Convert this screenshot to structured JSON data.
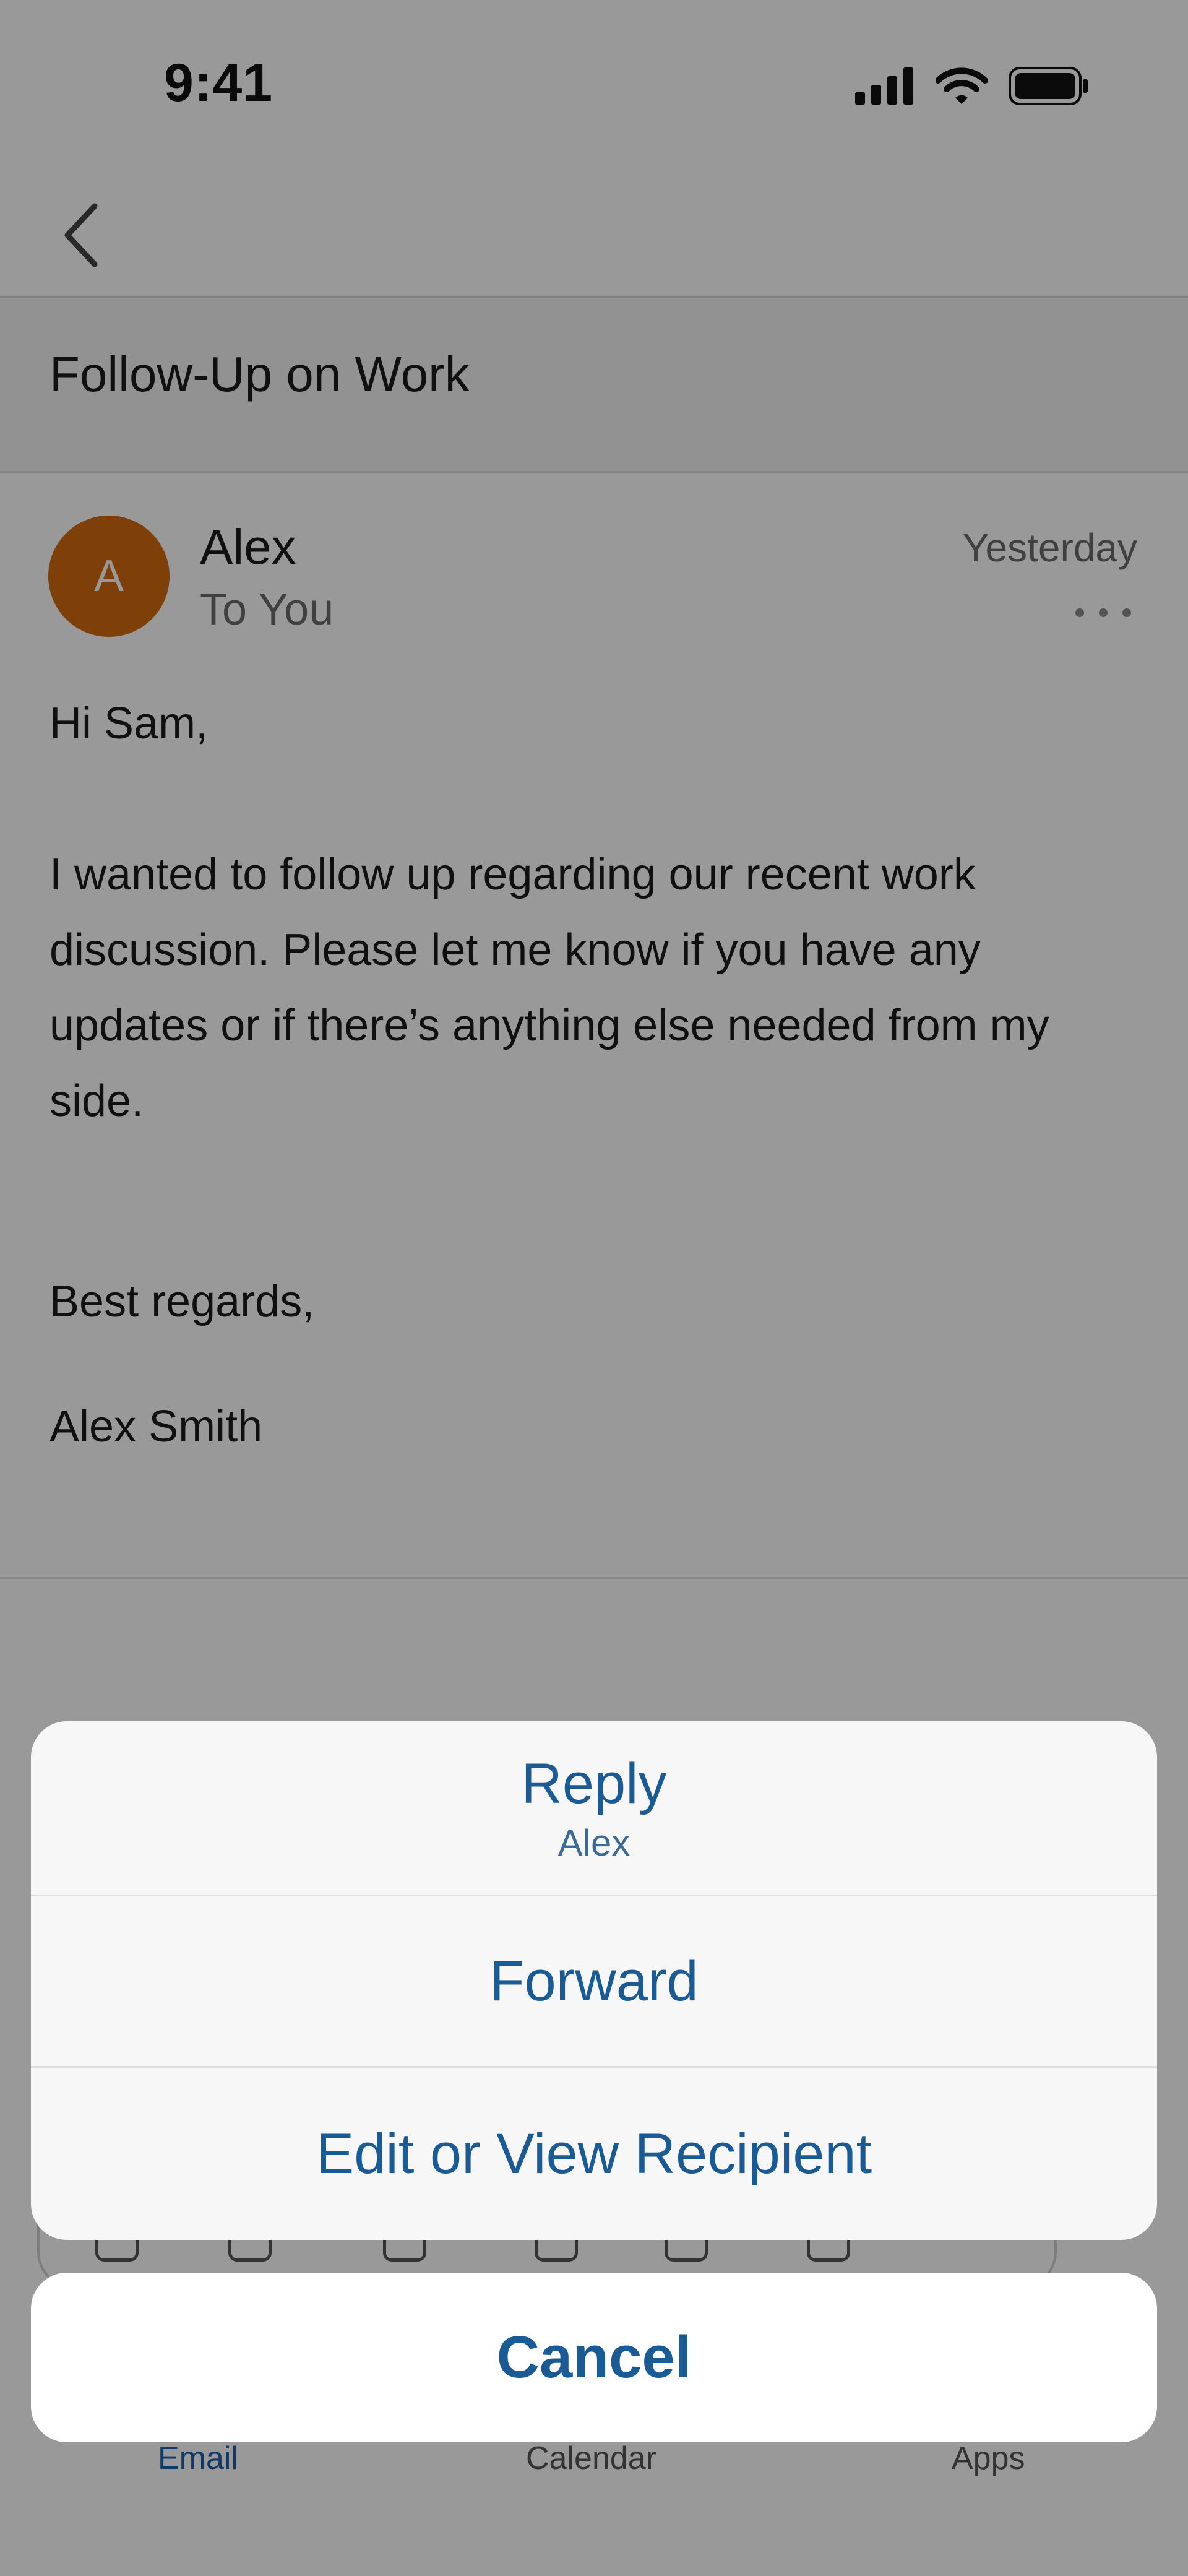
{
  "status_bar": {
    "time": "9:41"
  },
  "email": {
    "subject": "Follow-Up on Work",
    "sender": {
      "avatar_initial": "A",
      "name": "Alex",
      "to": "To You",
      "date": "Yesterday"
    },
    "body": {
      "greeting": "Hi Sam,",
      "paragraph": "I wanted to follow up regarding our recent work discussion. Please let me know if you have any updates or if there’s anything else needed from my side.",
      "signoff": "Best regards,",
      "signature": "Alex Smith"
    }
  },
  "tab_bar": {
    "email": "Email",
    "calendar": "Calendar",
    "apps": "Apps"
  },
  "action_sheet": {
    "reply_label": "Reply",
    "reply_subtitle": "Alex",
    "forward_label": "Forward",
    "edit_label": "Edit or View Recipient",
    "cancel_label": "Cancel"
  },
  "colors": {
    "accent": "#1a5b96",
    "avatar": "#d26a10"
  }
}
